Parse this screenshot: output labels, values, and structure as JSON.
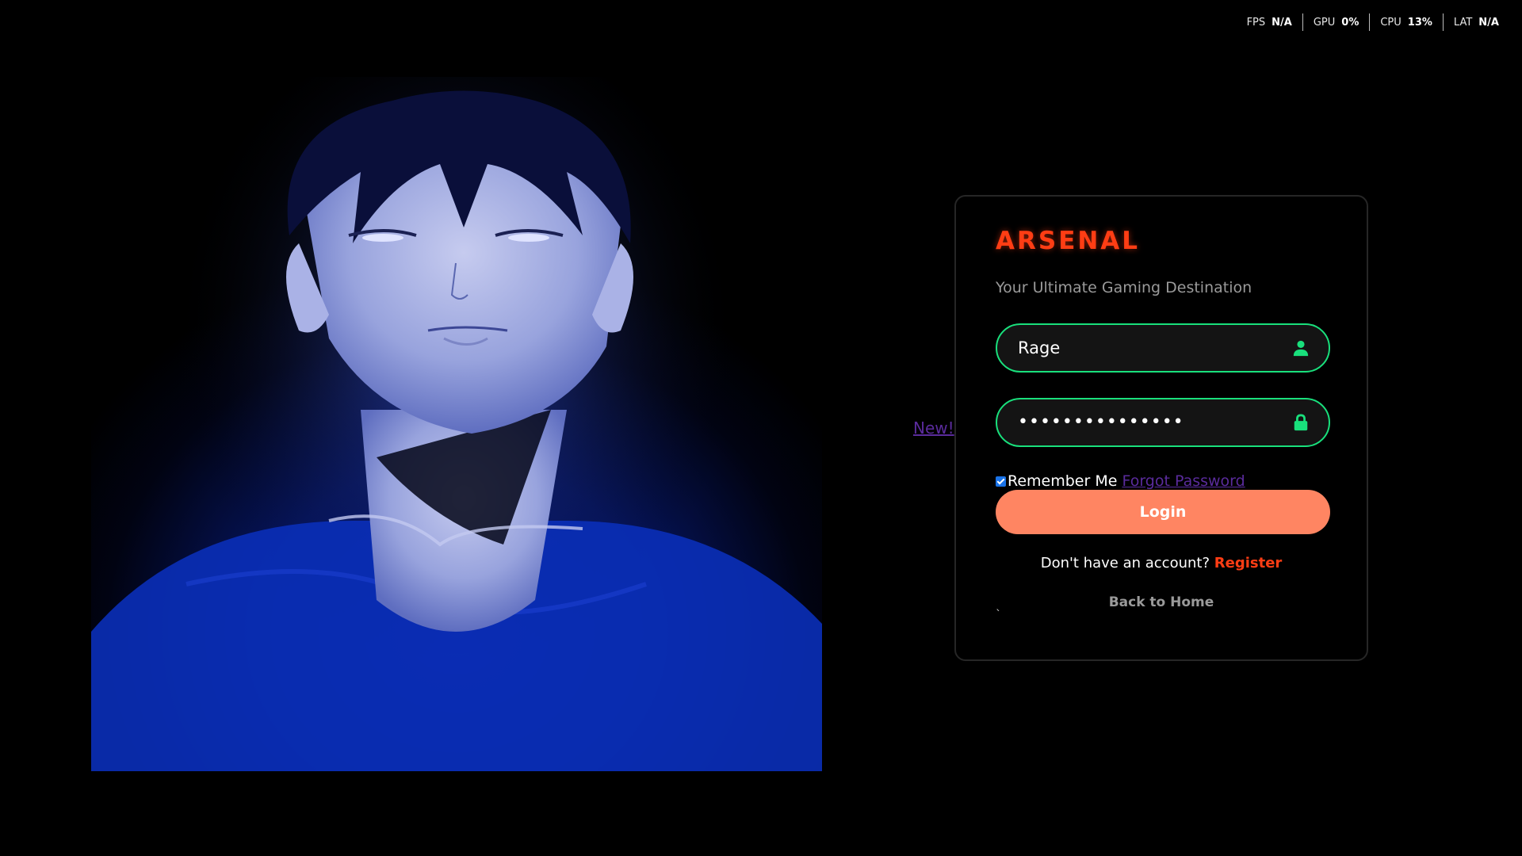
{
  "perf": [
    {
      "label": "FPS",
      "value": "N/A"
    },
    {
      "label": "GPU",
      "value": "0%"
    },
    {
      "label": "CPU",
      "value": "13%"
    },
    {
      "label": "LAT",
      "value": "N/A"
    }
  ],
  "new_link": "New!",
  "card": {
    "brand": "ARSENAL",
    "tagline": "Your Ultimate Gaming Destination",
    "username_value": "Rage",
    "password_value": "•••••••••••••••",
    "remember_label": "Remember Me",
    "remember_checked": true,
    "forgot_label": "Forgot Password",
    "login_label": "Login",
    "signup_prompt": "Don't have an account?",
    "register_label": "Register",
    "back_label": "Back to Home",
    "stray_char": "`"
  },
  "colors": {
    "brand": "#ff3d14",
    "field_border": "#19e07c",
    "login_button": "#ff8562",
    "link_visited": "#5a2b9c"
  },
  "icons": {
    "username": "user-icon",
    "password": "lock-icon"
  }
}
